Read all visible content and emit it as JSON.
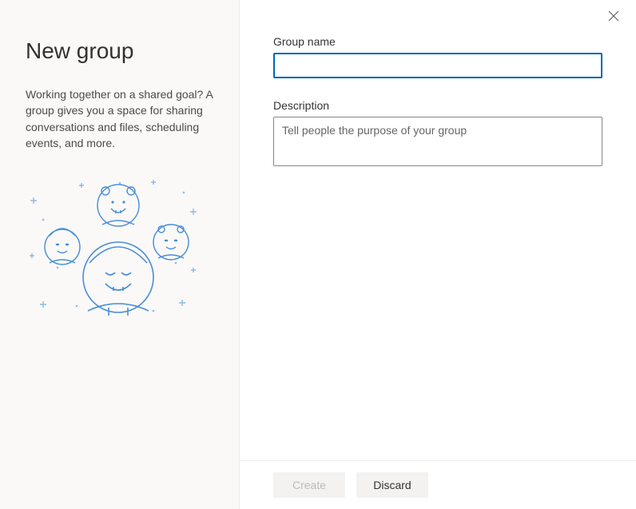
{
  "sidebar": {
    "title": "New group",
    "description": "Working together on a shared goal? A group gives you a space for sharing conversations and files, scheduling events, and more."
  },
  "form": {
    "group_name_label": "Group name",
    "group_name_value": "",
    "description_label": "Description",
    "description_value": "",
    "description_placeholder": "Tell people the purpose of your group"
  },
  "footer": {
    "create_label": "Create",
    "discard_label": "Discard"
  }
}
